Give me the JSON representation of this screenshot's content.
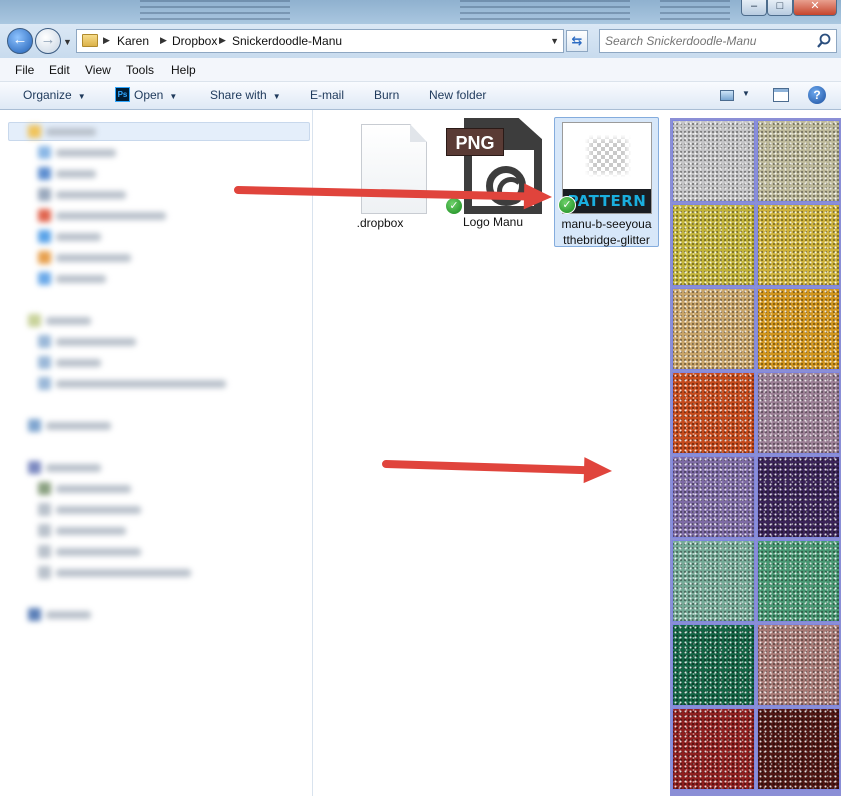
{
  "window": {
    "controls": {
      "minimize": "–",
      "maximize": "□",
      "close": "✕"
    }
  },
  "address": {
    "crumbs": [
      "Karen",
      "Dropbox",
      "Snickerdoodle-Manu"
    ],
    "search_placeholder": "Search Snickerdoodle-Manu"
  },
  "menu": [
    "File",
    "Edit",
    "View",
    "Tools",
    "Help"
  ],
  "toolbar": {
    "organize": "Organize",
    "open": "Open",
    "share_with": "Share with",
    "email": "E-mail",
    "burn": "Burn",
    "new_folder": "New folder",
    "help": "?"
  },
  "files": [
    {
      "name": ".dropbox",
      "icon": "blank-document-icon"
    },
    {
      "name": "Logo Manu",
      "icon": "png-file-icon",
      "badge": "PNG",
      "synced": true
    },
    {
      "name": "manu-b-seeyouatthebridge-glitter",
      "line1": "manu-b-seeyoua",
      "line2": "tthebridge-glitter",
      "icon": "pattern-file-icon",
      "badge": "PATTERN",
      "synced": true,
      "selected": true
    }
  ],
  "glitter_swatches": [
    "#c4c4c6",
    "#bdb99a",
    "#c2b43a",
    "#cdb23b",
    "#c8a468",
    "#d1951c",
    "#c54a1c",
    "#9b7f95",
    "#7d6aa4",
    "#3a2358",
    "#74a996",
    "#489873",
    "#136444",
    "#a67874",
    "#8e1e1e",
    "#4e1512"
  ],
  "colors": {
    "annotation_arrow": "#e0443c",
    "selection": "#d7e7f9"
  }
}
